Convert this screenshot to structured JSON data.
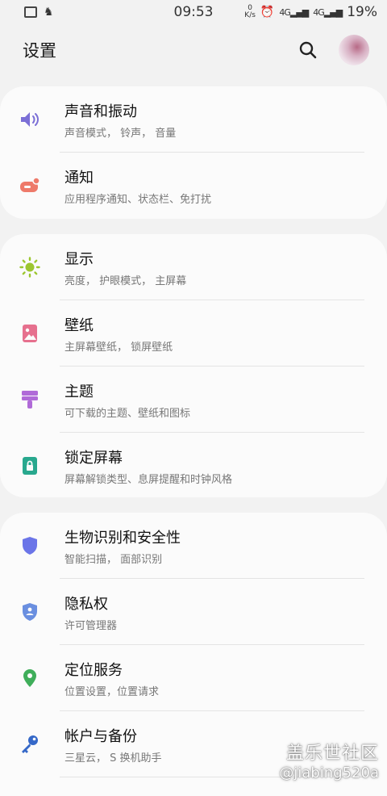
{
  "status_bar": {
    "time": "09:53",
    "net_speed_value": "0",
    "net_speed_unit": "K/s",
    "signal_1": "4G",
    "signal_2": "4G",
    "battery": "19%"
  },
  "header": {
    "title": "设置"
  },
  "groups": [
    {
      "items": [
        {
          "title": "声音和振动",
          "subtitle": "声音模式， 铃声， 音量",
          "icon": "speaker-icon",
          "color": "#7b6fd6"
        },
        {
          "title": "通知",
          "subtitle": "应用程序通知、状态栏、免打扰",
          "icon": "notification-icon",
          "color": "#ee7a6a"
        }
      ]
    },
    {
      "items": [
        {
          "title": "显示",
          "subtitle": "亮度， 护眼模式， 主屏幕",
          "icon": "brightness-icon",
          "color": "#9cc630"
        },
        {
          "title": "壁纸",
          "subtitle": "主屏幕壁纸， 锁屏壁纸",
          "icon": "wallpaper-icon",
          "color": "#e6708e"
        },
        {
          "title": "主题",
          "subtitle": "可下载的主题、壁纸和图标",
          "icon": "theme-brush-icon",
          "color": "#b06ad8"
        },
        {
          "title": "锁定屏幕",
          "subtitle": "屏幕解锁类型、息屏提醒和时钟风格",
          "icon": "lock-screen-icon",
          "color": "#28a88e"
        }
      ]
    },
    {
      "items": [
        {
          "title": "生物识别和安全性",
          "subtitle": "智能扫描， 面部识别",
          "icon": "shield-icon",
          "color": "#6b75e8"
        },
        {
          "title": "隐私权",
          "subtitle": "许可管理器",
          "icon": "privacy-shield-icon",
          "color": "#6a8fe0"
        },
        {
          "title": "定位服务",
          "subtitle": "位置设置，位置请求",
          "icon": "location-pin-icon",
          "color": "#3fae5a"
        },
        {
          "title": "帐户与备份",
          "subtitle": "三星云， S 换机助手",
          "icon": "key-icon",
          "color": "#3568c8"
        }
      ]
    }
  ],
  "watermark": {
    "brand": "盖乐世社区",
    "handle": "@jiabing520a"
  }
}
